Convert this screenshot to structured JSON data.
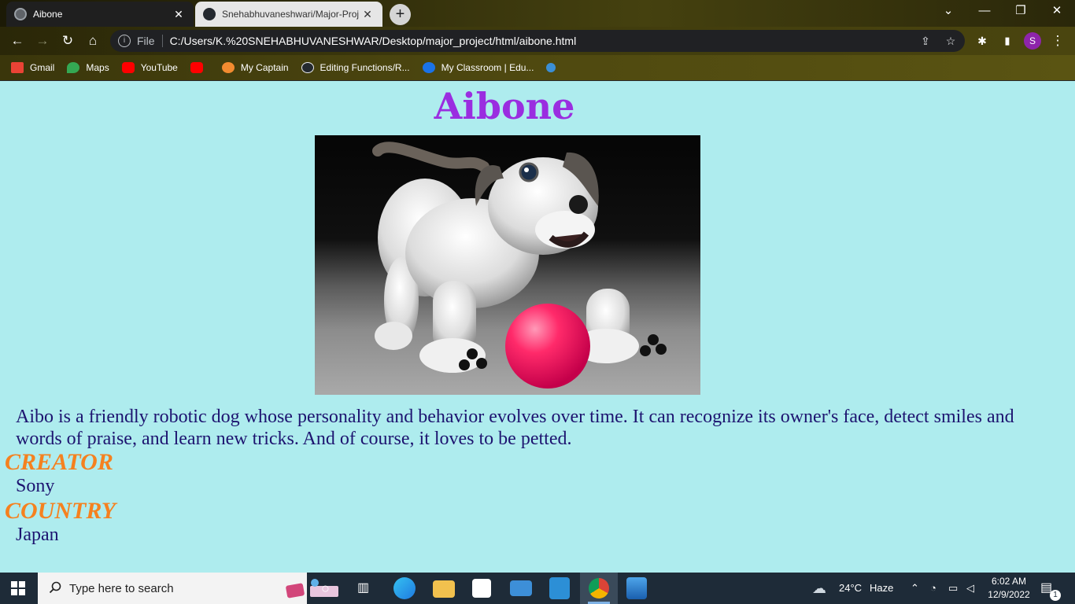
{
  "tabs": [
    {
      "title": "Aibone",
      "close": "✕",
      "active": true
    },
    {
      "title": "Snehabhuvaneshwari/Major-Proj",
      "close": "✕",
      "active": false
    }
  ],
  "window_controls": {
    "tabsearch": "⌄",
    "minimize": "—",
    "restore": "❐",
    "close": "✕"
  },
  "toolbar": {
    "back": "←",
    "forward": "→",
    "reload": "↻",
    "home": "⌂"
  },
  "omnibox": {
    "info_icon": "i",
    "scheme_label": "File",
    "url": "C:/Users/K.%20SNEHABHUVANESHWAR/Desktop/major_project/html/aibone.html",
    "share": "⇪",
    "star": "☆"
  },
  "profile": {
    "initial": "S"
  },
  "bookmarks": [
    {
      "label": "Gmail",
      "color": "#ea4335"
    },
    {
      "label": "Maps",
      "color": "#34a853"
    },
    {
      "label": "YouTube",
      "color": "#ff0000"
    },
    {
      "label": "",
      "color": "#ff0000"
    },
    {
      "label": "My Captain",
      "color": "#f28b30"
    },
    {
      "label": "Editing Functions/R...",
      "color": "#e8eaed"
    },
    {
      "label": "My Classroom | Edu...",
      "color": "#1a73e8"
    }
  ],
  "page": {
    "title": "Aibone",
    "description": "Aibo is a friendly robotic dog whose personality and behavior evolves over time. It can recognize its owner's face, detect smiles and words of praise, and learn new tricks. And of course, it loves to be petted.",
    "creator_label": "CREATOR",
    "creator_value": "Sony",
    "country_label": "COUNTRY",
    "country_value": "Japan",
    "title_color": "#9a2de0",
    "label_color": "#f5811f",
    "text_color": "#1d1470",
    "background": "#aeecee"
  },
  "taskbar": {
    "search_placeholder": "Type here to search",
    "weather_temp": "24°C",
    "weather_text": "Haze",
    "time": "6:02 AM",
    "date": "12/9/2022",
    "notification_count": "1"
  }
}
